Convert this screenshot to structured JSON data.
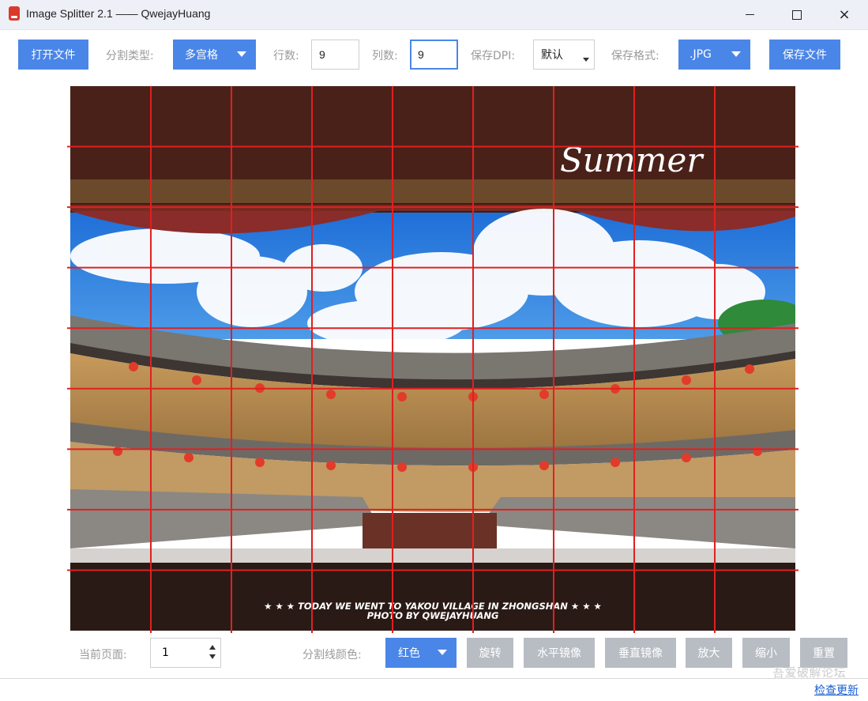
{
  "window": {
    "title": "Image Splitter 2.1 —— QwejayHuang",
    "controls": {
      "minimize": "minimize",
      "maximize": "maximize",
      "close": "×"
    }
  },
  "toolbar": {
    "open_file": "打开文件",
    "split_type_label": "分割类型:",
    "split_type_value": "多宫格",
    "rows_label": "行数:",
    "rows_value": "9",
    "cols_label": "列数:",
    "cols_value": "9",
    "dpi_label": "保存DPI:",
    "dpi_value": "默认",
    "format_label": "保存格式:",
    "format_value": ".JPG",
    "save_file": "保存文件"
  },
  "canvas": {
    "image": {
      "handwriting": "Summer",
      "caption_line1": "★ ★ ★ TODAY WE WENT TO YAKOU VILLAGE IN ZHONGSHAN ★ ★ ★",
      "caption_line2": "PHOTO BY QWEJAYHUANG"
    },
    "grid": {
      "rows": 9,
      "cols": 9,
      "line_color": "#e02020"
    }
  },
  "bottom": {
    "current_page_label": "当前页面:",
    "current_page_value": "1",
    "line_color_label": "分割线颜色:",
    "line_color_value": "红色",
    "rotate": "旋转",
    "h_mirror": "水平镜像",
    "v_mirror": "垂直镜像",
    "zoom_in": "放大",
    "zoom_out": "缩小",
    "reset": "重置"
  },
  "status": {
    "check_update": "检查更新",
    "watermark": "吾爱破解论坛"
  },
  "colors": {
    "accent": "#4a86e8",
    "disabled_button": "#b8bdc4",
    "grid_line": "#e02020"
  }
}
